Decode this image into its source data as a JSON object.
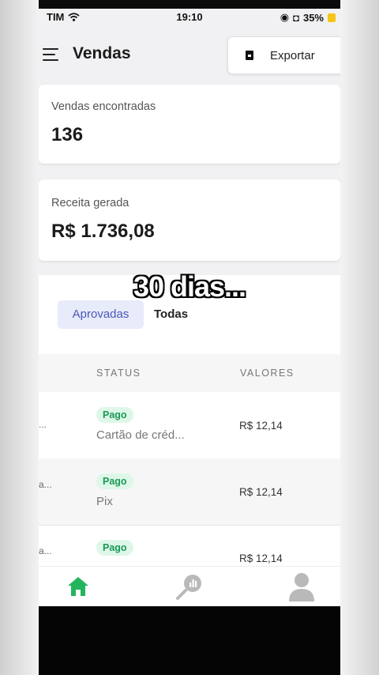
{
  "status_bar": {
    "carrier": "TIM",
    "time": "19:10",
    "battery": "35%"
  },
  "header": {
    "title": "Vendas",
    "export_label": "Exportar"
  },
  "cards": {
    "sales_found_label": "Vendas encontradas",
    "sales_found_value": "136",
    "revenue_label": "Receita gerada",
    "revenue_value": "R$ 1.736,08"
  },
  "overlay_caption": "30 dias...",
  "tabs": {
    "approved": "Aprovadas",
    "all": "Todas"
  },
  "table": {
    "headers": {
      "status": "STATUS",
      "values": "VALORES"
    },
    "rows": [
      {
        "left": "...",
        "status": "Pago",
        "method": "Cartão de créd...",
        "amount": "R$ 12,14"
      },
      {
        "left": "a...",
        "status": "Pago",
        "method": "Pix",
        "amount": "R$ 12,14"
      },
      {
        "left": "a...",
        "status": "Pago",
        "method": "",
        "amount": "R$ 12,14"
      }
    ]
  },
  "colors": {
    "accent": "#4b58b8",
    "success": "#1a9a55",
    "home_active": "#22b55e"
  },
  "icons": [
    "menu-icon",
    "export-icon",
    "wifi-icon",
    "home-icon",
    "search-icon",
    "user-icon"
  ]
}
